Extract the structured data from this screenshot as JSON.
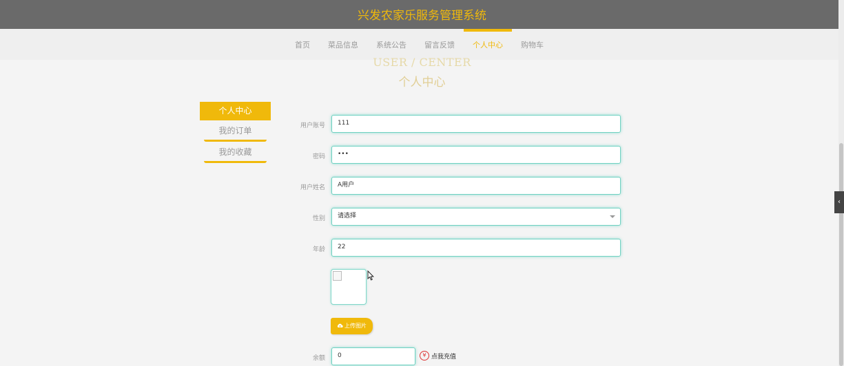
{
  "header": {
    "title": "兴发农家乐服务管理系统"
  },
  "nav": {
    "items": [
      {
        "label": "首页"
      },
      {
        "label": "菜品信息"
      },
      {
        "label": "系统公告"
      },
      {
        "label": "留言反馈"
      },
      {
        "label": "个人中心",
        "active": true
      },
      {
        "label": "购物车"
      }
    ]
  },
  "page": {
    "heading_en": "USER / CENTER",
    "heading_cn": "个人中心"
  },
  "sidebar": {
    "items": [
      {
        "label": "个人中心",
        "active": true
      },
      {
        "label": "我的订单"
      },
      {
        "label": "我的收藏"
      }
    ]
  },
  "form": {
    "account": {
      "label": "用户账号",
      "value": "111"
    },
    "password": {
      "label": "密码",
      "value": "•••"
    },
    "name": {
      "label": "用户姓名",
      "value": "A用户"
    },
    "gender": {
      "label": "性别",
      "value": "请选择"
    },
    "age": {
      "label": "年龄",
      "value": "22"
    },
    "upload_label": "上传图片",
    "balance": {
      "label": "余额",
      "value": "0"
    },
    "recharge_label": "点我充值"
  },
  "icons": {
    "upload": "cloud-upload-icon",
    "recharge": "yen-icon",
    "toggle": "chevron-left-icon"
  },
  "colors": {
    "accent": "#f0b90b",
    "header_bg": "#6a6a6a",
    "input_border": "#6fd1c1"
  }
}
